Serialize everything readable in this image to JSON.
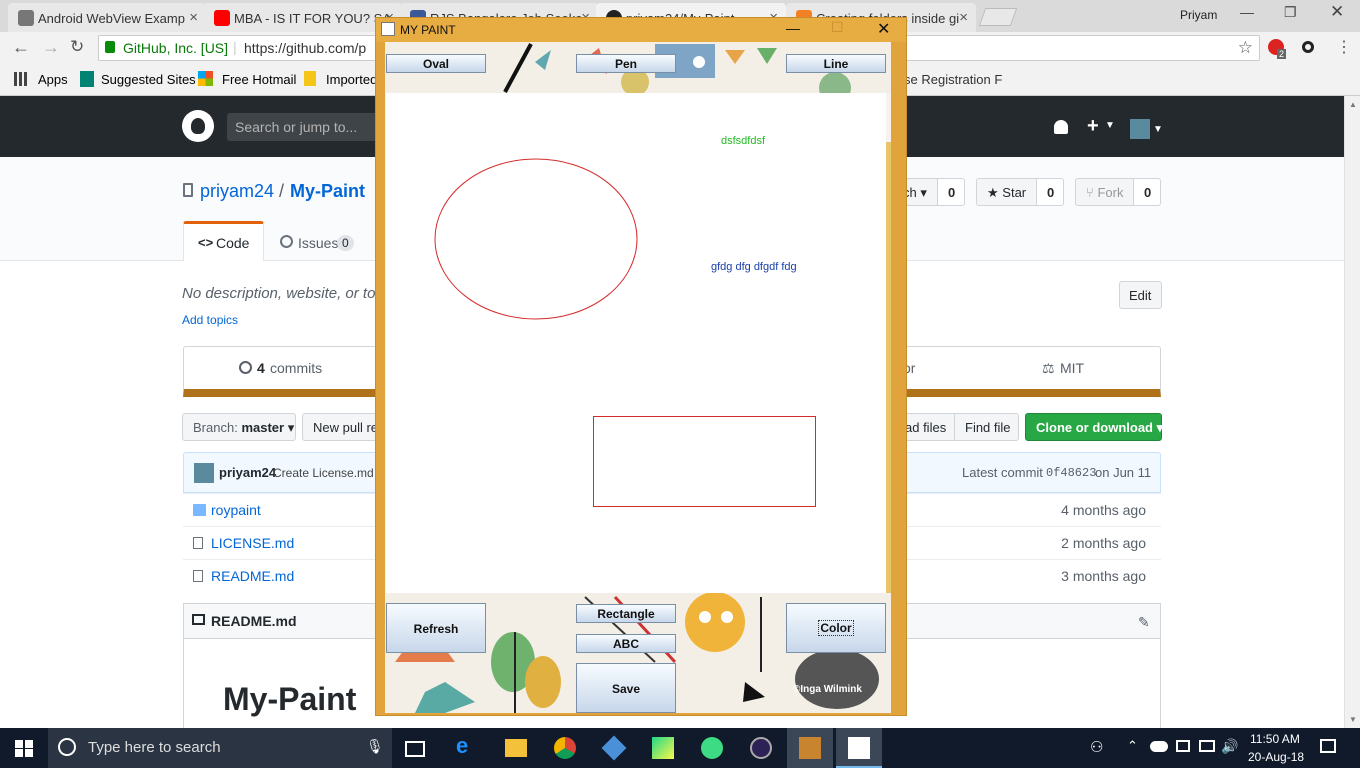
{
  "browser": {
    "tabs": [
      {
        "title": "Android WebView Examp",
        "icon": "typekit-icon",
        "color": "#555555"
      },
      {
        "title": "MBA - IS IT FOR YOU? SA",
        "icon": "youtube-icon",
        "color": "#ff0000"
      },
      {
        "title": "RJS Bangalore Job Seeke",
        "icon": "facebook-icon",
        "color": "#3b5998"
      },
      {
        "title": "priyam24/My-Paint",
        "icon": "github-icon",
        "color": "#222222"
      },
      {
        "title": "Creating folders inside gi",
        "icon": "stackoverflow-icon",
        "color": "#f48024"
      }
    ],
    "profile_name": "Priyam",
    "secure_label": "GitHub, Inc. [US]",
    "url": "https://github.com/p",
    "extension_badge": "2",
    "bookmarks": [
      "Apps",
      "Suggested Sites",
      "Free Hotmail",
      "Imported",
      "se Registration F"
    ]
  },
  "github": {
    "search_placeholder": "Search or jump to...",
    "owner": "priyam24",
    "separator": "/",
    "repo": "My-Paint",
    "watch_label": "ch",
    "watch_count": "0",
    "star_label": "Star",
    "star_count": "0",
    "fork_label": "Fork",
    "fork_count": "0",
    "tab_code": "Code",
    "tab_issues": "Issues",
    "issues_count": "0",
    "description": "No description, website, or to",
    "add_topics": "Add topics",
    "edit_label": "Edit",
    "commits_count": "4",
    "commits_label": "commits",
    "contributors_partial": "or",
    "license_label": "MIT",
    "branch_prefix": "Branch:",
    "branch_name": "master",
    "new_pull_label": "New pull re",
    "upload_partial": "ad files",
    "find_file": "Find file",
    "clone_label": "Clone or download",
    "commit_author": "priyam24",
    "commit_message": "Create License.md",
    "latest_commit_label": "Latest commit",
    "commit_hash": "0f48623",
    "commit_date": "on Jun 11",
    "files": [
      {
        "name": "roypaint",
        "type": "folder",
        "age": "4 months ago"
      },
      {
        "name": "LICENSE.md",
        "type": "file",
        "age": "2 months ago"
      },
      {
        "name": "README.md",
        "type": "file",
        "age": "3 months ago"
      }
    ],
    "readme_title": "README.md",
    "readme_heading": "My-Paint"
  },
  "paint": {
    "window_title": "MY PAINT",
    "buttons": {
      "oval": "Oval",
      "pen": "Pen",
      "line": "Line",
      "refresh": "Refresh",
      "rectangle": "Rectangle",
      "abc": "ABC",
      "color": "Color",
      "save": "Save"
    },
    "canvas_texts": [
      {
        "text": "dsfsdfdsf",
        "color": "#22bb22"
      },
      {
        "text": "gfdg dfg dfgdf fdg",
        "color": "#1a3fa8"
      }
    ],
    "shape_color": "#d42a2a",
    "watermark": "©Inga Wilmink"
  },
  "taskbar": {
    "search_placeholder": "Type here to search",
    "time": "11:50 AM",
    "date": "20-Aug-18"
  }
}
